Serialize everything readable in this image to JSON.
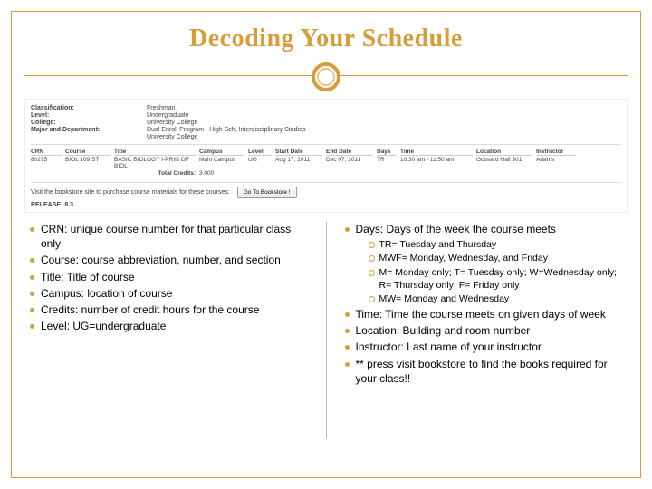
{
  "title": "Decoding Your Schedule",
  "info": {
    "classification_label": "Classification:",
    "classification_value": "Freshman",
    "level_label": "Level:",
    "level_value": "Undergraduate",
    "college_label": "College:",
    "college_value": "University College",
    "major_label": "Major and Department:",
    "major_value": "Dual Enroll Program - High Sch, Interdisciplinary Studies",
    "major_value2": "University College"
  },
  "headers": {
    "crn": "CRN",
    "course": "Course",
    "title": "Title",
    "campus": "Campus",
    "level": "Level",
    "start": "Start Date",
    "end": "End Date",
    "days": "Days",
    "time": "Time",
    "location": "Location",
    "instructor": "Instructor"
  },
  "row": {
    "crn": "80275",
    "course": "BIOL 109 ST",
    "title": "BASIC BIOLOGY I-PRIN OF BIOL",
    "campus": "Main Campus",
    "level": "UG",
    "start": "Aug 17, 2011",
    "end": "Dec 07, 2011",
    "days": "TR",
    "time": "10:30 am - 11:50 am",
    "location": "Gossard Hall 301",
    "instructor": "Adams"
  },
  "credits_label": "Total Credits:",
  "credits_value": "3.000",
  "row_credits": "3.000",
  "bookstore_text": "Visit the bookstore site to purchase course materials for these courses:",
  "bookstore_button": "Go To Bookstore !",
  "release": "RELEASE: 8.3",
  "left": [
    "CRN:  unique course number for that particular class only",
    "Course:  course abbreviation, number, and section",
    "Title:  Title of course",
    "Campus:  location of course",
    "Credits:  number of credit hours for the course",
    "Level:  UG=undergraduate"
  ],
  "right_days": "Days:  Days of the week the course meets",
  "right_sub": [
    "TR= Tuesday and Thursday",
    "MWF= Monday, Wednesday, and Friday",
    "M= Monday only; T= Tuesday only; W=Wednesday only; R= Thursday only; F= Friday only",
    "MW= Monday and Wednesday"
  ],
  "right_rest": [
    "Time:  Time the course meets on given days of week",
    "Location:  Building and room number",
    "Instructor:  Last name of your instructor",
    "** press visit bookstore to find the books required for your class!!"
  ]
}
